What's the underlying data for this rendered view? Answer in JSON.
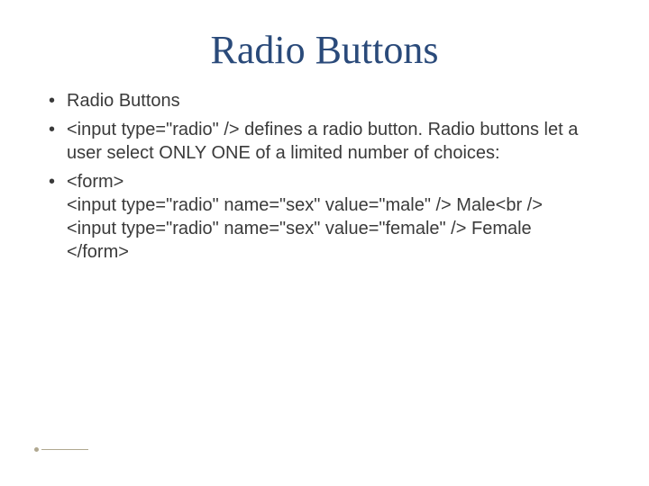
{
  "title": "Radio Buttons",
  "bullets": [
    {
      "text": "Radio Buttons"
    },
    {
      "text": "<input type=\"radio\" /> defines a radio button. Radio buttons let a user select ONLY ONE of a limited number of choices:"
    },
    {
      "text": "<form>\n<input type=\"radio\" name=\"sex\" value=\"male\" /> Male<br />\n<input type=\"radio\" name=\"sex\" value=\"female\" /> Female\n</form>"
    }
  ]
}
